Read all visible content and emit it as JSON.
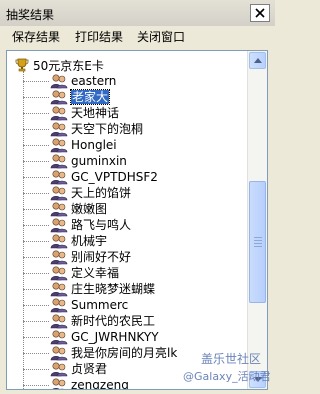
{
  "window": {
    "title": "抽奖结果"
  },
  "menu": {
    "items": [
      {
        "label": "保存结果"
      },
      {
        "label": "打印结果"
      },
      {
        "label": "关闭窗口"
      }
    ]
  },
  "tree": {
    "root_label": "50元京东E卡",
    "entries": [
      {
        "label": "eastern",
        "selected": false
      },
      {
        "label": "老家大",
        "selected": true
      },
      {
        "label": "天地神话",
        "selected": false
      },
      {
        "label": "天空下的泡桐",
        "selected": false
      },
      {
        "label": "Honglei",
        "selected": false
      },
      {
        "label": "guminxin",
        "selected": false
      },
      {
        "label": "GC_VPTDHSF2",
        "selected": false
      },
      {
        "label": "天上的馅饼",
        "selected": false
      },
      {
        "label": "嫩嫩图",
        "selected": false
      },
      {
        "label": "路飞与鸣人",
        "selected": false
      },
      {
        "label": "机械宇",
        "selected": false
      },
      {
        "label": "别闹好不好",
        "selected": false
      },
      {
        "label": "定义幸福",
        "selected": false
      },
      {
        "label": "庄生晓梦迷蝴蝶",
        "selected": false
      },
      {
        "label": "Summerc",
        "selected": false
      },
      {
        "label": "新时代的农民工",
        "selected": false
      },
      {
        "label": "GC_JWRHNKYY",
        "selected": false
      },
      {
        "label": "我是你房间的月亮lk",
        "selected": false
      },
      {
        "label": "贞贤君",
        "selected": false
      },
      {
        "label": "zengzeng",
        "selected": false
      }
    ]
  },
  "watermark": {
    "line1": "盖乐世社区",
    "line2": "@Galaxy_活动君"
  },
  "icons": {
    "close": "close-icon",
    "trophy": "trophy-icon",
    "avatar": "user-group-icon",
    "scroll_up": "arrow-up-icon",
    "scroll_down": "arrow-down-icon"
  },
  "colors": {
    "selection": "#316ac5",
    "window_bg": "#ece9d8",
    "panel_bg": "#ffffff"
  }
}
